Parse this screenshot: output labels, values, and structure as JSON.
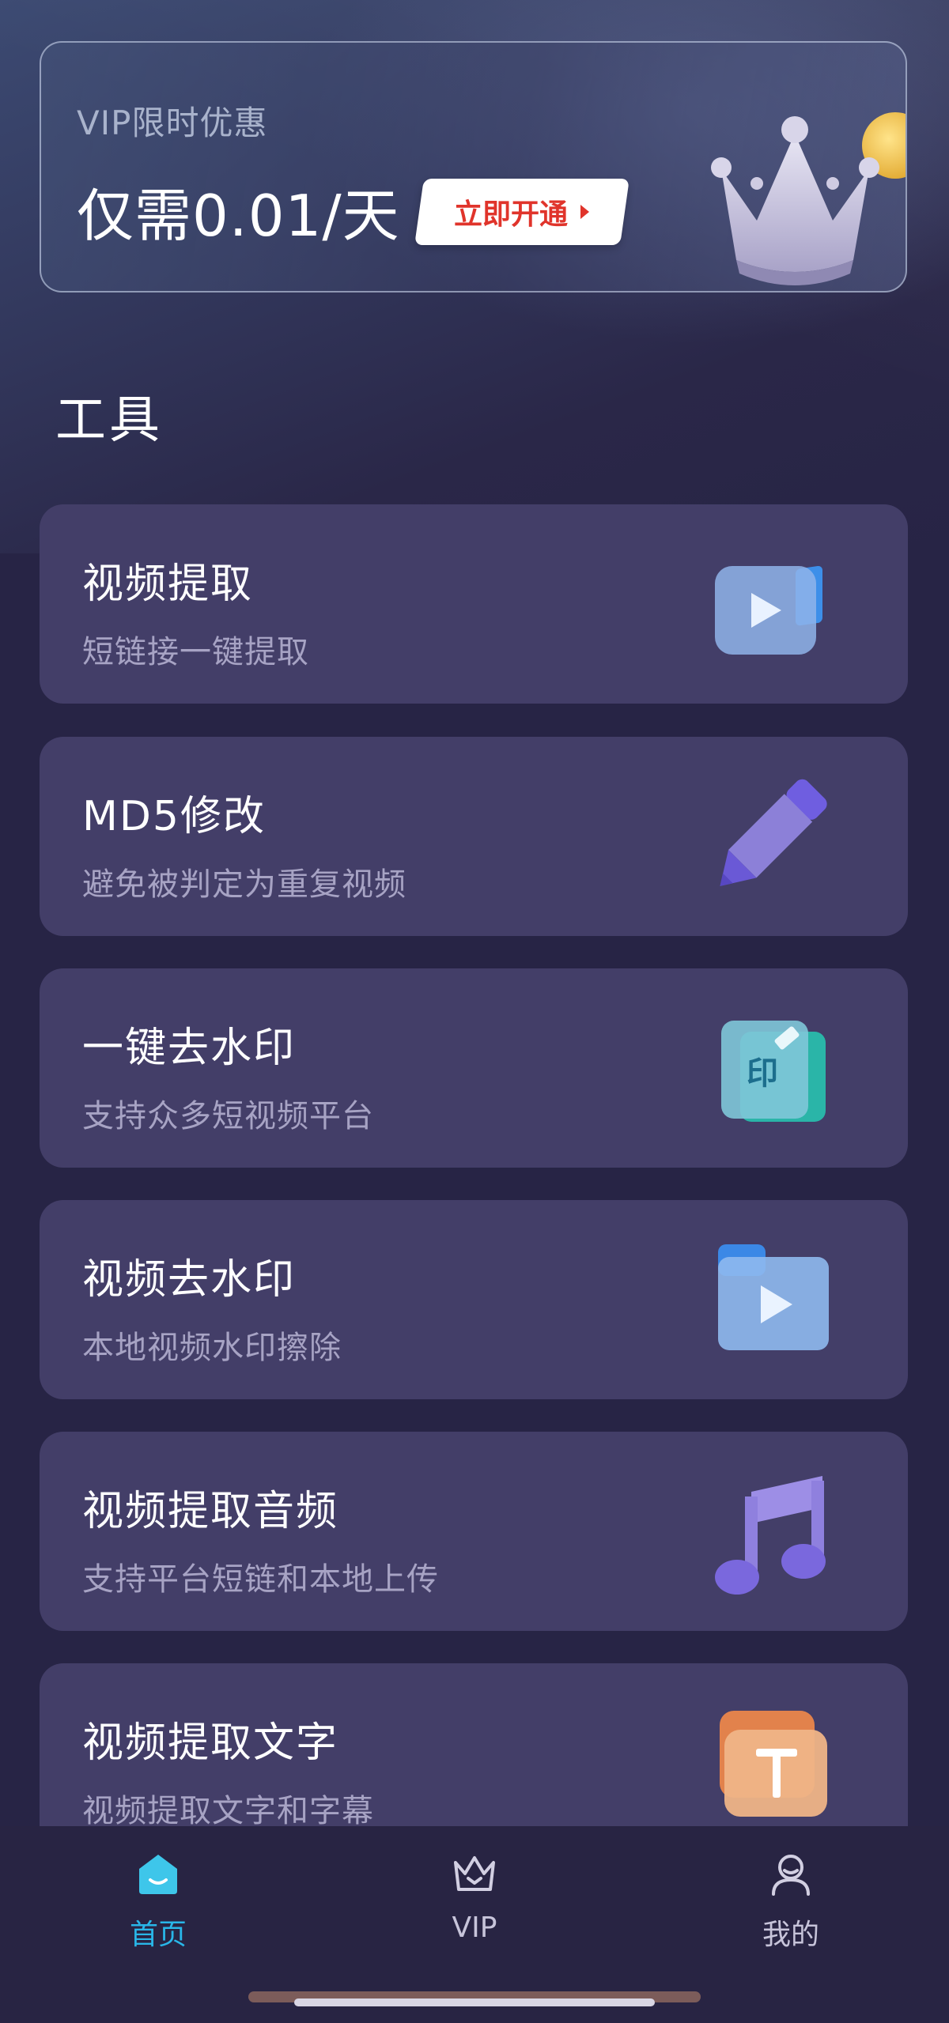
{
  "banner": {
    "label": "VIP限时优惠",
    "price": "仅需0.01/天",
    "button_label": "立即开通"
  },
  "section": {
    "title": "工具"
  },
  "tools": [
    {
      "title": "视频提取",
      "subtitle": "短链接一键提取",
      "icon": "video-camera-icon"
    },
    {
      "title": "MD5修改",
      "subtitle": "避免被判定为重复视频",
      "icon": "pencil-icon"
    },
    {
      "title": "一键去水印",
      "subtitle": "支持众多短视频平台",
      "icon": "watermark-stamp-icon"
    },
    {
      "title": "视频去水印",
      "subtitle": "本地视频水印擦除",
      "icon": "video-folder-icon"
    },
    {
      "title": "视频提取音频",
      "subtitle": "支持平台短链和本地上传",
      "icon": "music-note-icon"
    },
    {
      "title": "视频提取文字",
      "subtitle": "视频提取文字和字幕",
      "icon": "text-t-icon"
    }
  ],
  "nav": {
    "items": [
      {
        "label": "首页",
        "icon": "home-icon",
        "active": true
      },
      {
        "label": "VIP",
        "icon": "crown-icon",
        "active": false
      },
      {
        "label": "我的",
        "icon": "profile-icon",
        "active": false
      }
    ]
  },
  "colors": {
    "background": "#272445",
    "card": "#433e68",
    "accent": "#29b6e8",
    "button_text": "#e0342b"
  }
}
